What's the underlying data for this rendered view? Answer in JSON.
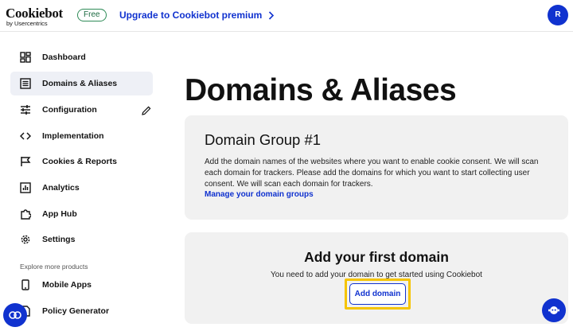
{
  "header": {
    "logo_name": "Cookiebot",
    "logo_sub": "by Usercentrics",
    "plan_badge": "Free",
    "upgrade_label": "Upgrade to Cookiebot premium",
    "avatar_initial": "R"
  },
  "sidebar": {
    "items": [
      {
        "label": "Dashboard",
        "icon": "dashboard-icon",
        "active": false
      },
      {
        "label": "Domains & Aliases",
        "icon": "list-icon",
        "active": true
      },
      {
        "label": "Configuration",
        "icon": "sliders-icon",
        "active": false
      },
      {
        "label": "Implementation",
        "icon": "code-icon",
        "active": false
      },
      {
        "label": "Cookies & Reports",
        "icon": "flag-icon",
        "active": false
      },
      {
        "label": "Analytics",
        "icon": "chart-icon",
        "active": false
      },
      {
        "label": "App Hub",
        "icon": "puzzle-icon",
        "active": false
      },
      {
        "label": "Settings",
        "icon": "gear-icon",
        "active": false
      },
      {
        "label": "Mobile Apps",
        "icon": "mobile-icon",
        "active": false
      },
      {
        "label": "Policy Generator",
        "icon": "document-icon",
        "active": false
      }
    ],
    "explore_caption": "Explore more products"
  },
  "main": {
    "page_title": "Domains & Aliases",
    "group": {
      "title": "Domain Group #1",
      "description": "Add the domain names of the websites where you want to enable cookie consent. We will scan each domain for trackers. Please add the domains for which you want to start collecting user consent. We will scan each domain for trackers.",
      "manage_link": "Manage your domain groups"
    },
    "empty_state": {
      "title": "Add your first domain",
      "description": "You need to add your domain to get started using Cookiebot",
      "button_label": "Add domain"
    }
  },
  "colors": {
    "brand_blue": "#1032cf",
    "highlight_yellow": "#f5c400",
    "badge_green": "#2e8b57",
    "card_gray": "#f1f1f1",
    "active_nav_bg": "#eef0f6"
  }
}
